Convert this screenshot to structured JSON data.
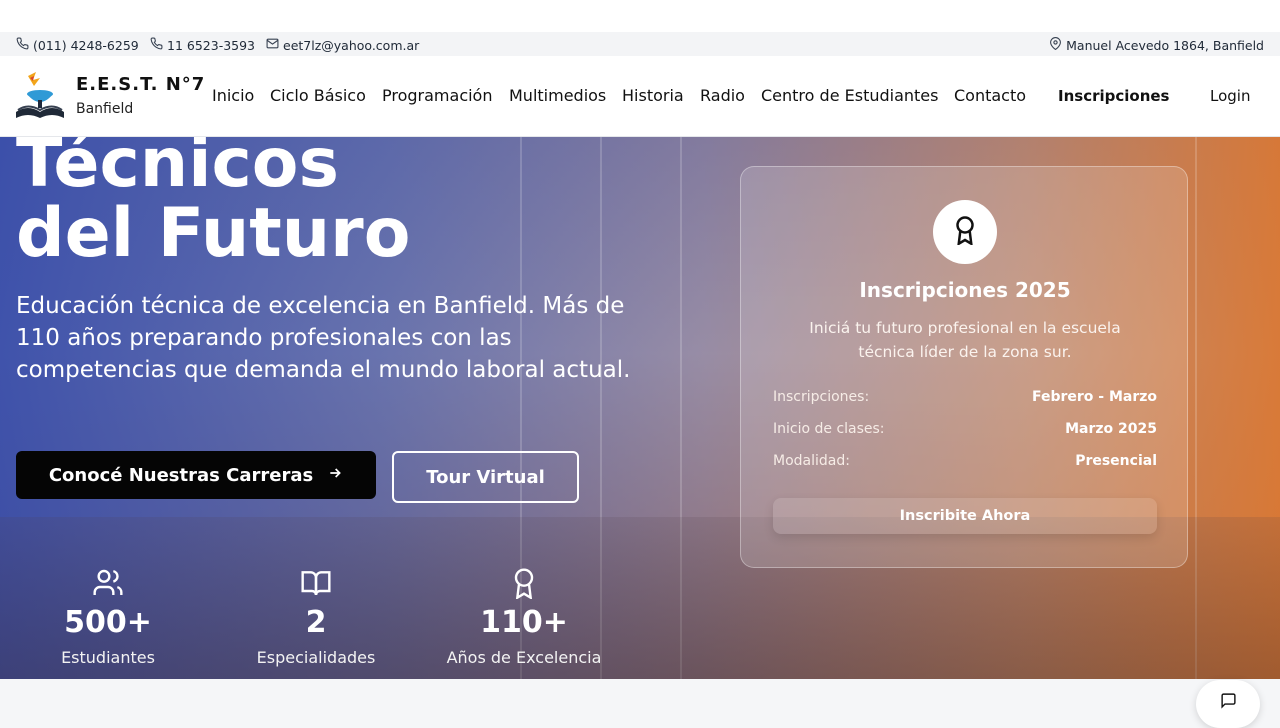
{
  "contact_bar": {
    "phone1": "(011) 4248-6259",
    "phone2": "11 6523-3593",
    "email": "eet7lz@yahoo.com.ar",
    "address": "Manuel Acevedo 1864, Banfield"
  },
  "brand": {
    "name": "E.E.S.T. N°7",
    "location": "Banfield"
  },
  "nav": {
    "items": [
      "Inicio",
      "Ciclo Básico",
      "Programación",
      "Multimedios",
      "Historia",
      "Radio",
      "Centro de Estudiantes",
      "Contacto"
    ],
    "cta": "Inscripciones",
    "login": "Login"
  },
  "hero": {
    "headline_line1": "Técnicos",
    "headline_line2": "del Futuro",
    "subtitle": "Educación técnica de excelencia en Banfield. Más de 110 años preparando profesionales con las competencias que demanda el mundo laboral actual.",
    "primary_button": "Conocé Nuestras Carreras",
    "secondary_button": "Tour Virtual",
    "stats": [
      {
        "value": "500+",
        "label": "Estudiantes",
        "icon": "users-icon"
      },
      {
        "value": "2",
        "label": "Especialidades",
        "icon": "book-open-icon"
      },
      {
        "value": "110+",
        "label": "Años de Excelencia",
        "icon": "award-icon"
      }
    ]
  },
  "card": {
    "icon": "award-icon",
    "title": "Inscripciones 2025",
    "description": "Iniciá tu futuro profesional en la escuela técnica líder de la zona sur.",
    "rows": [
      {
        "label": "Inscripciones:",
        "value": "Febrero - Marzo"
      },
      {
        "label": "Inicio de clases:",
        "value": "Marzo 2025"
      },
      {
        "label": "Modalidad:",
        "value": "Presencial"
      }
    ],
    "button": "Inscribite Ahora"
  },
  "chat": {
    "icon": "chat-icon"
  },
  "colors": {
    "hero_blue": "#384caa",
    "hero_orange": "#dc7832",
    "button_dark": "#050505",
    "white": "#ffffff"
  }
}
